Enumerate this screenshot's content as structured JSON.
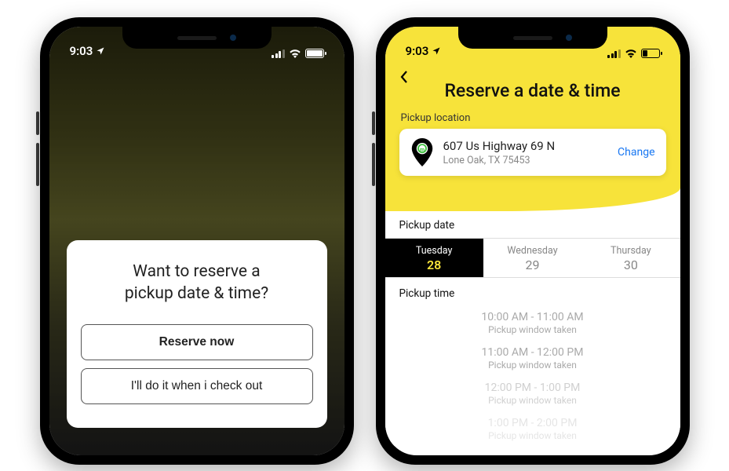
{
  "status": {
    "time": "9:03"
  },
  "modal": {
    "title_line1": "Want to reserve a",
    "title_line2": "pickup date & time?",
    "primary_label": "Reserve now",
    "secondary_label": "I'll do it when i check out"
  },
  "reserve": {
    "header_title": "Reserve a date & time",
    "pickup_location_label": "Pickup location",
    "address_line1": "607 Us Highway 69 N",
    "address_line2": "Lone Oak, TX 75453",
    "change_label": "Change",
    "pickup_date_label": "Pickup date",
    "dates": [
      {
        "day": "Tuesday",
        "num": "28",
        "selected": true
      },
      {
        "day": "Wednesday",
        "num": "29",
        "selected": false
      },
      {
        "day": "Thursday",
        "num": "30",
        "selected": false
      }
    ],
    "pickup_time_label": "Pickup time",
    "time_slots": [
      {
        "range": "10:00 AM  - 11:00 AM",
        "status": "Pickup window taken"
      },
      {
        "range": "11:00 AM  - 12:00 PM",
        "status": "Pickup window taken"
      },
      {
        "range": "12:00 PM  - 1:00 PM",
        "status": "Pickup window taken"
      },
      {
        "range": "1:00 PM - 2:00 PM",
        "status": "Pickup window taken"
      }
    ]
  }
}
